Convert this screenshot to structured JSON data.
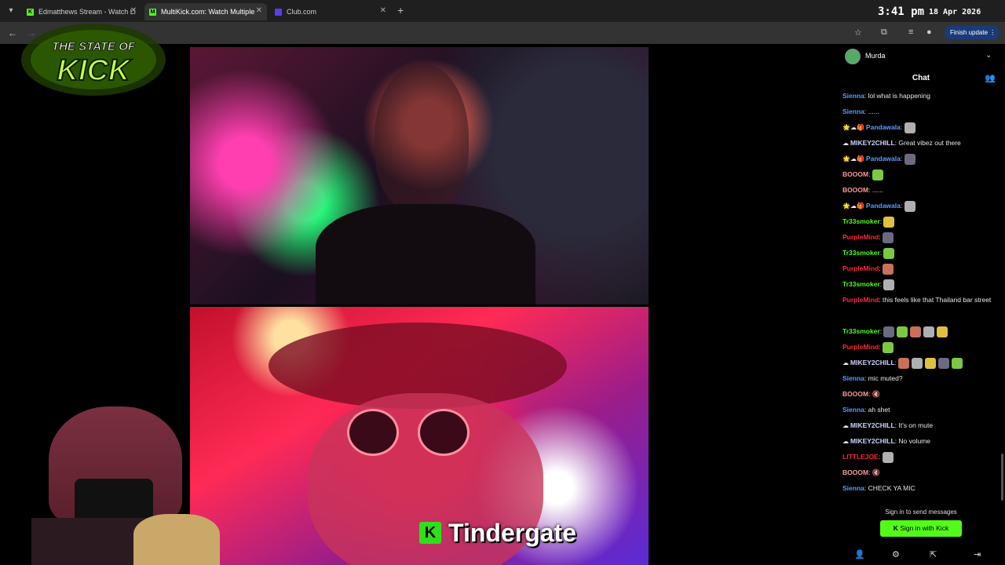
{
  "browser": {
    "tabs": [
      {
        "title": "Edmatthews Stream - Watch Li",
        "favicon": "kick-icon",
        "favicon_color": "#53fc18",
        "active": false
      },
      {
        "title": "MultiKick.com: Watch Multiple",
        "favicon": "multikick-icon",
        "favicon_color": "#53fc18",
        "active": true
      },
      {
        "title": "Club.com",
        "favicon": "club-icon",
        "favicon_color": "#5b3cf0",
        "active": false
      }
    ],
    "new_tab_glyph": "+",
    "clock_time": "3:41 pm",
    "clock_date": "18 Apr 2026",
    "finish_update_label": "Finish update"
  },
  "overlay": {
    "logo_line1": "THE STATE OF",
    "logo_line2": "KICK"
  },
  "video": {
    "caption_icon": "K",
    "caption_text": "Tindergate"
  },
  "chat": {
    "channel": "Murda",
    "title": "Chat",
    "messages": [
      {
        "user": "Sienna",
        "color": "#5b9bff",
        "text": "lol what is happening",
        "emotes": 0
      },
      {
        "user": "Sienna",
        "color": "#5b9bff",
        "text": "......",
        "emotes": 0
      },
      {
        "user": "Pandawala",
        "color": "#5b9bff",
        "badges": "🌟☁🎁",
        "text": "",
        "emotes": 1
      },
      {
        "user": "MIKEY2CHILL",
        "color": "#c9d6ff",
        "badges": "☁",
        "text": "Great vibez out there",
        "emotes": 0
      },
      {
        "user": "Pandawala",
        "color": "#5b9bff",
        "badges": "🌟☁🎁",
        "text": "",
        "emotes": 1
      },
      {
        "user": "BOOOM",
        "color": "#ff9a9a",
        "text": "",
        "emotes": 1
      },
      {
        "user": "BOOOM",
        "color": "#ff9a9a",
        "text": "......",
        "emotes": 0
      },
      {
        "user": "Pandawala",
        "color": "#5b9bff",
        "badges": "🌟☁🎁",
        "text": "",
        "emotes": 1
      },
      {
        "user": "Tr33smoker",
        "color": "#53fc18",
        "text": "",
        "emotes": 1
      },
      {
        "user": "PurpleMind",
        "color": "#ff2a3a",
        "text": "",
        "emotes": 1
      },
      {
        "user": "Tr33smoker",
        "color": "#53fc18",
        "text": "",
        "emotes": 1
      },
      {
        "user": "PurpleMind",
        "color": "#ff2a3a",
        "text": "",
        "emotes": 1
      },
      {
        "user": "Tr33smoker",
        "color": "#53fc18",
        "text": "",
        "emotes": 1
      },
      {
        "user": "PurpleMind",
        "color": "#ff2a3a",
        "text": "this feels like that Thailand bar street",
        "emotes": 0,
        "tall": true
      },
      {
        "user": "Tr33smoker",
        "color": "#53fc18",
        "text": "",
        "emotes": 5
      },
      {
        "user": "PurpleMind",
        "color": "#ff2a3a",
        "text": "",
        "emotes": 1
      },
      {
        "user": "MIKEY2CHILL",
        "color": "#c9d6ff",
        "badges": "☁",
        "text": "",
        "emotes": 5
      },
      {
        "user": "Sienna",
        "color": "#5b9bff",
        "text": "mic muted?",
        "emotes": 0
      },
      {
        "user": "BOOOM",
        "color": "#ff9a9a",
        "text": "🔇",
        "emotes": 0
      },
      {
        "user": "Sienna",
        "color": "#5b9bff",
        "text": "ah shet",
        "emotes": 0
      },
      {
        "user": "MIKEY2CHILL",
        "color": "#c9d6ff",
        "badges": "☁",
        "text": "It's on mute",
        "emotes": 0
      },
      {
        "user": "MIKEY2CHILL",
        "color": "#c9d6ff",
        "badges": "☁",
        "text": "No volume",
        "emotes": 0
      },
      {
        "user": "LITTLEJOE",
        "color": "#ff2a3a",
        "text": "",
        "emotes": 1
      },
      {
        "user": "BOOOM",
        "color": "#ff9a9a",
        "text": "🔇",
        "emotes": 0
      },
      {
        "user": "Sienna",
        "color": "#5b9bff",
        "text": "CHECK YA MIC",
        "emotes": 0
      }
    ],
    "signin_prompt": "Sign in to send messages",
    "signin_button": "Sign in with Kick"
  },
  "colors": {
    "kick_green": "#53fc18",
    "update_blue": "#1b3a7a"
  }
}
